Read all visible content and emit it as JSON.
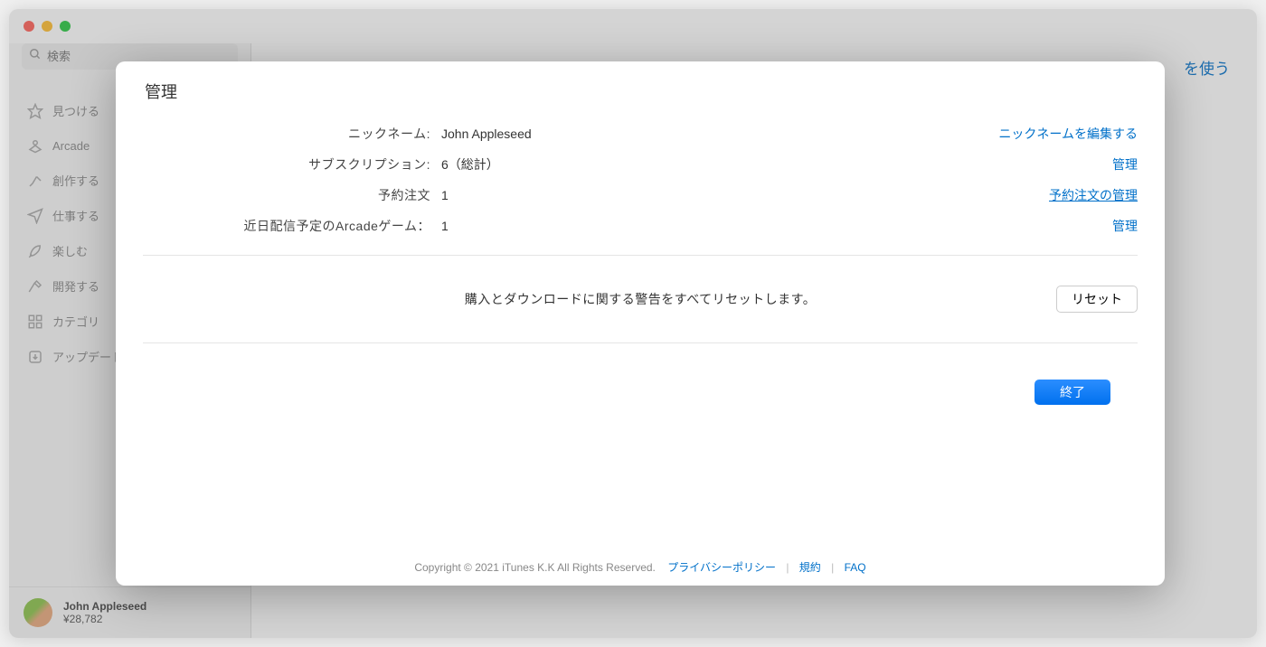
{
  "search": {
    "placeholder": "検索"
  },
  "sidebar": {
    "items": [
      {
        "label": "見つける"
      },
      {
        "label": "Arcade"
      },
      {
        "label": "創作する"
      },
      {
        "label": "仕事する"
      },
      {
        "label": "楽しむ"
      },
      {
        "label": "開発する"
      },
      {
        "label": "カテゴリ"
      },
      {
        "label": "アップデート"
      }
    ]
  },
  "user": {
    "name": "John Appleseed",
    "balance": "¥28,782"
  },
  "header": {
    "link_fragment": "を使う"
  },
  "modal": {
    "title": "管理",
    "rows": {
      "nickname": {
        "label": "ニックネーム:",
        "value": "John Appleseed",
        "action": "ニックネームを編集する"
      },
      "subscriptions": {
        "label": "サブスクリプション:",
        "value": "6（総計）",
        "action": "管理"
      },
      "preorders": {
        "label": "予約注文",
        "value": "1",
        "action": "予約注文の管理"
      },
      "arcade": {
        "label": "近日配信予定のArcadeゲーム：",
        "value": "1",
        "action": "管理"
      }
    },
    "reset": {
      "text": "購入とダウンロードに関する警告をすべてリセットします。",
      "button": "リセット"
    },
    "done": "終了",
    "footer": {
      "copyright": "Copyright © 2021 iTunes K.K All Rights Reserved.",
      "privacy": "プライバシーポリシー",
      "terms": "規約",
      "faq": "FAQ"
    }
  }
}
